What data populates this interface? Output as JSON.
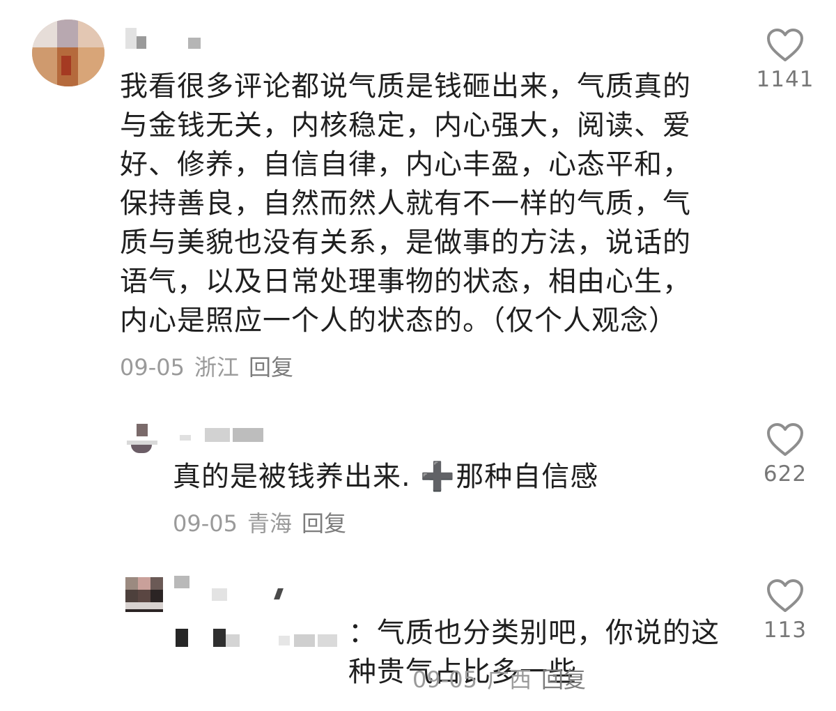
{
  "comments": [
    {
      "text": "我看很多评论都说气质是钱砸出来，气质真的与金钱无关，内核稳定，内心强大，阅读、爱好、修养，自信自律，内心丰盈，心态平和，保持善良，自然而然人就有不一样的气质，气质与美貌也没有关系，是做事的方法，说话的语气，以及日常处理事物的状态，相由心生，内心是照应一个人的状态的。（仅个人观念）",
      "date": "09-05",
      "location": "浙江",
      "reply_label": "回复",
      "likes": "1141",
      "like_icon": "heart-outline-icon"
    },
    {
      "text": "真的是被钱养出来. ➕那种自信感",
      "date": "09-05",
      "location": "青海",
      "reply_label": "回复",
      "likes": "622",
      "like_icon": "heart-outline-icon"
    },
    {
      "text": "：气质也分类别吧，你说的这种贵气占比多一些",
      "date": "09-05",
      "location": "广西",
      "reply_label": "回复",
      "likes": "113",
      "like_icon": "heart-outline-icon"
    }
  ],
  "colors": {
    "meta": "#9a9a9a",
    "body": "#1f1f1f",
    "background": "#ffffff"
  }
}
